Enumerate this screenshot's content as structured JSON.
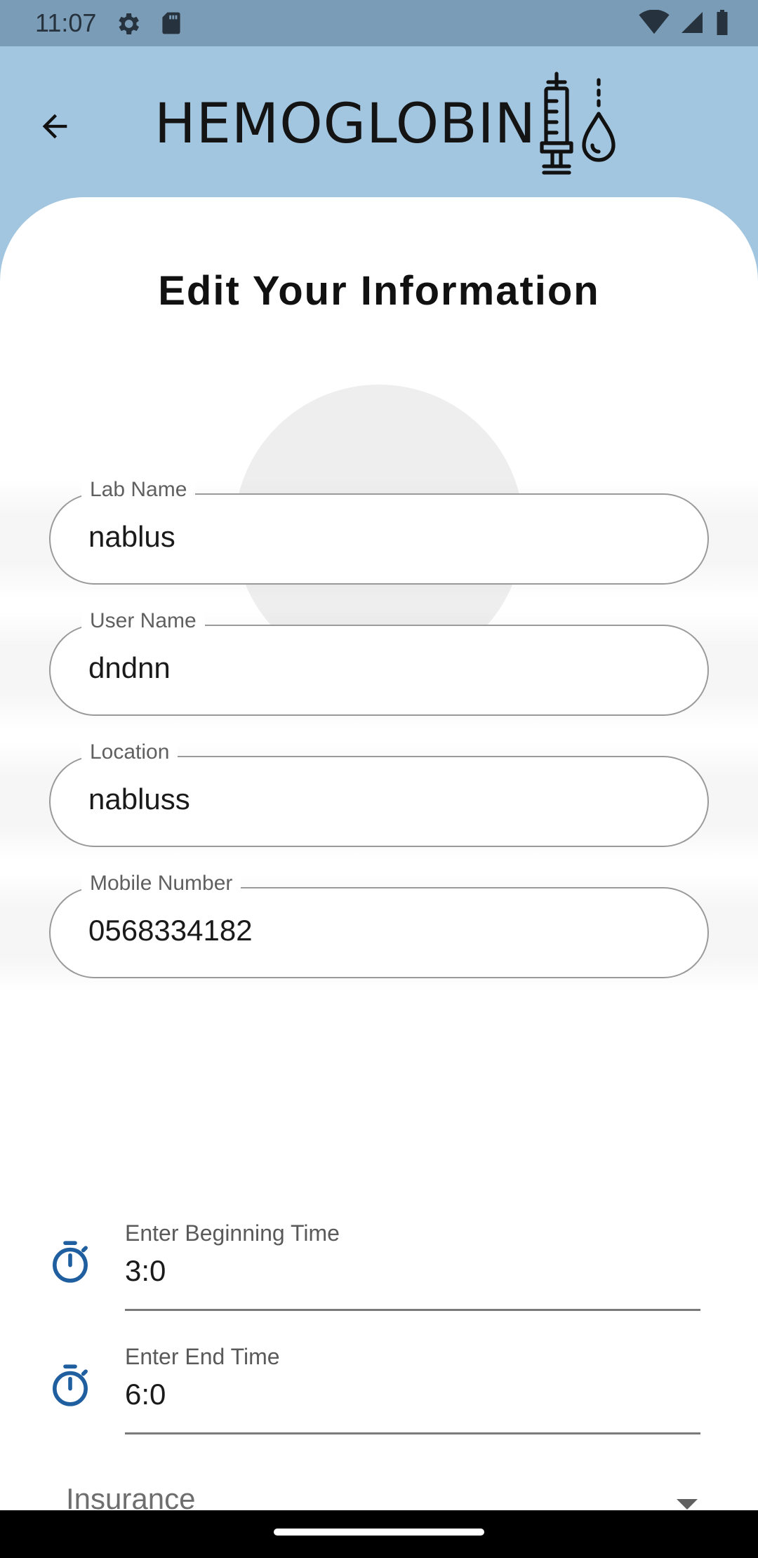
{
  "status_bar": {
    "time": "11:07",
    "icons": [
      "settings-icon",
      "sd-card-icon",
      "wifi-icon",
      "signal-icon",
      "battery-icon"
    ]
  },
  "app_bar": {
    "back_icon": "arrow-back-icon",
    "logo_text": "HEMOGLOBIN",
    "logo_icon": "syringe-drop-icon"
  },
  "page": {
    "title": "Edit Your Information",
    "avatar_icon": "person-add-icon"
  },
  "form": {
    "lab_name": {
      "label": "Lab Name",
      "value": "nablus"
    },
    "user_name": {
      "label": "User Name",
      "value": "dndnn"
    },
    "location": {
      "label": "Location",
      "value": "nabluss"
    },
    "mobile_number": {
      "label": "Mobile Number",
      "value": "0568334182"
    },
    "begin_time": {
      "label": "Enter Beginning Time",
      "value": "3:0",
      "icon": "timer-icon"
    },
    "end_time": {
      "label": "Enter End Time",
      "value": "6:0",
      "icon": "timer-icon"
    },
    "insurance": {
      "label": "Insurance",
      "icon": "dropdown-arrow-icon"
    }
  },
  "colors": {
    "app_bar_bg": "#a3c6e0",
    "status_bar_bg": "#7b9cb7",
    "accent": "#1f5fa0",
    "avatar_bg": "#eeeeee"
  }
}
